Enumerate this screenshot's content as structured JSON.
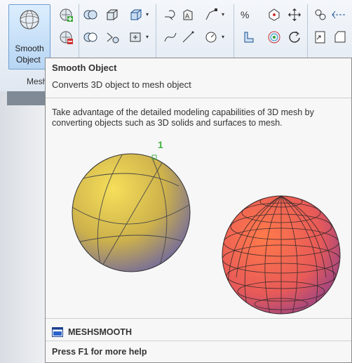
{
  "ribbon": {
    "smooth_object": {
      "line1": "Smooth",
      "line2": "Object"
    },
    "panel_label": "Mesh"
  },
  "tooltip": {
    "title": "Smooth Object",
    "description": "Converts 3D object to mesh object",
    "body_line1": "Take advantage of the detailed modeling capabilities of 3D mesh by",
    "body_line2": "converting objects such as 3D solids and surfaces to mesh.",
    "callout_number": "1",
    "command": "MESHSMOOTH",
    "help": "Press F1 for more help"
  },
  "colors": {
    "solid_sphere": "#d4b84a",
    "mesh_sphere": "#ef6550",
    "callout": "#43b043"
  }
}
